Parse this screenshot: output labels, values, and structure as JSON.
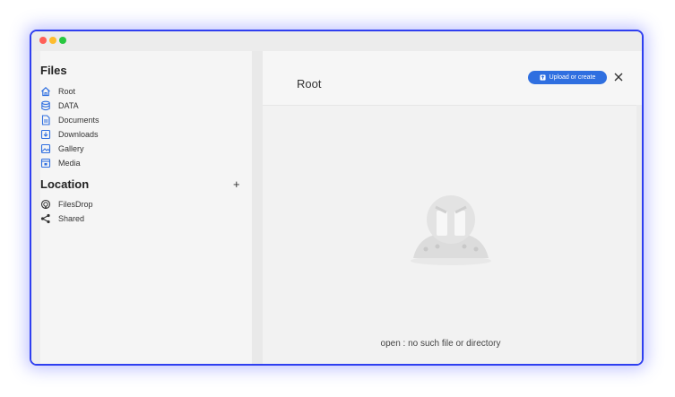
{
  "sidebar": {
    "files_title": "Files",
    "files_items": [
      {
        "label": "Root",
        "icon": "home-icon"
      },
      {
        "label": "DATA",
        "icon": "database-icon"
      },
      {
        "label": "Documents",
        "icon": "document-icon"
      },
      {
        "label": "Downloads",
        "icon": "download-icon"
      },
      {
        "label": "Gallery",
        "icon": "image-icon"
      },
      {
        "label": "Media",
        "icon": "media-icon"
      }
    ],
    "location_title": "Location",
    "add_location": "+",
    "location_items": [
      {
        "label": "FilesDrop",
        "icon": "airdrop-icon"
      },
      {
        "label": "Shared",
        "icon": "share-icon"
      }
    ]
  },
  "header": {
    "breadcrumb": "Root",
    "upload_label": "Upload or create",
    "close_symbol": "✕"
  },
  "content": {
    "error_message": "open : no such file or directory"
  },
  "colors": {
    "accent": "#2f6fe0",
    "window_border": "#2f3ff0",
    "icon_blue": "#2f6fe0"
  }
}
